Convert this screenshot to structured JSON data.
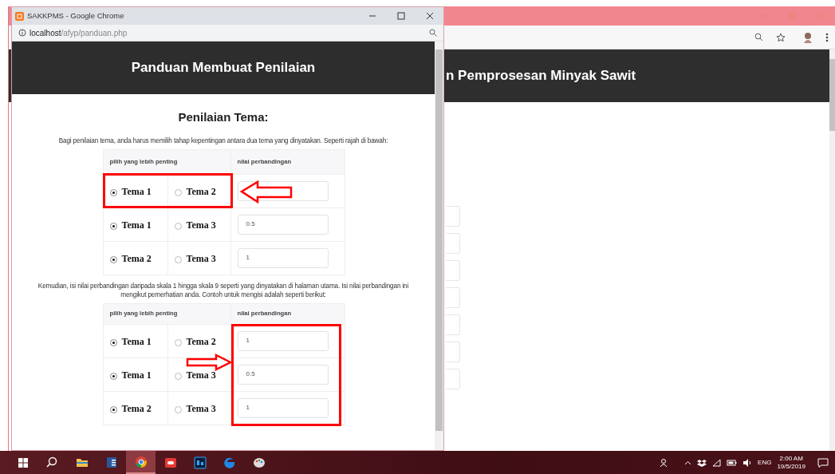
{
  "background_window": {
    "heading": "n Pemprosesan Minyak Sawit"
  },
  "popup_window": {
    "title": "SAKKPMS - Google Chrome",
    "url_host": "localhost",
    "url_path": "/afyp/panduan.php",
    "header": "Panduan Membuat Penilaian",
    "section_title": "Penilaian Tema:",
    "blocks": [
      {
        "kind": "paragraph",
        "text": "Bagi penilaian tema, anda harus memilih tahap kepentingan antara dua tema yang dinyatakan. Seperti rajah di bawah:"
      },
      {
        "kind": "table",
        "columns": [
          "pilih yang lebih penting",
          "nilai perbandingan"
        ],
        "marks": {
          "frame_first_row_options": true,
          "arrow_left": true
        },
        "rows": [
          {
            "options": [
              {
                "label": "Tema 1",
                "selected": true
              },
              {
                "label": "Tema 2",
                "selected": false
              }
            ]
          },
          {
            "options": [
              {
                "label": "Tema 1",
                "selected": true
              },
              {
                "label": "Tema 3",
                "selected": false
              }
            ],
            "value": "0.5"
          },
          {
            "options": [
              {
                "label": "Tema 2",
                "selected": true
              },
              {
                "label": "Tema 3",
                "selected": false
              }
            ],
            "value": "1"
          }
        ]
      },
      {
        "kind": "paragraph",
        "text": "Kemudian, isi nilai perbandingan daripada skala 1 hingga skala 9 seperti yang dinyatakan di halaman utama. Isi nilai perbandingan ini mengikut pemerhatian anda. Contoh untuk mengisi adalah seperti berikut:"
      },
      {
        "kind": "table",
        "columns": [
          "pilih yang lebih penting",
          "nilai perbandingan"
        ],
        "marks": {
          "frame_values": true,
          "arrow_right": true
        },
        "rows": [
          {
            "options": [
              {
                "label": "Tema 1",
                "selected": true
              },
              {
                "label": "Tema 2",
                "selected": false
              }
            ],
            "value": "1"
          },
          {
            "options": [
              {
                "label": "Tema 1",
                "selected": true
              },
              {
                "label": "Tema 3",
                "selected": false
              }
            ],
            "value": "0.5"
          },
          {
            "options": [
              {
                "label": "Tema 2",
                "selected": true
              },
              {
                "label": "Tema 3",
                "selected": false
              }
            ],
            "value": "1"
          }
        ]
      }
    ]
  },
  "taskbar": {
    "apps": [
      {
        "kind": "search",
        "selected": false
      },
      {
        "kind": "explorer",
        "selected": false
      },
      {
        "kind": "word",
        "selected": false
      },
      {
        "kind": "chrome",
        "selected": true
      },
      {
        "kind": "xampp",
        "selected": false
      },
      {
        "kind": "photoshop",
        "selected": false
      },
      {
        "kind": "edge",
        "selected": false
      },
      {
        "kind": "paint",
        "selected": false
      }
    ],
    "language": "ENG",
    "time": "2:00 AM",
    "date": "19/5/2019"
  }
}
